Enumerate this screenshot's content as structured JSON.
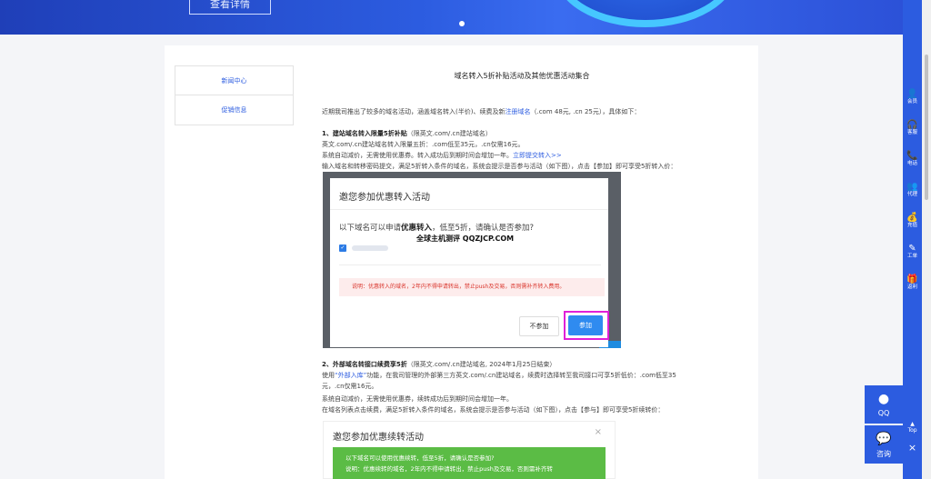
{
  "banner": {
    "detail_button": "查看详情"
  },
  "sidenav": {
    "items": [
      "新闻中心",
      "促销信息"
    ]
  },
  "article": {
    "title": "域名转入5折补贴活动及其他优惠活动集合",
    "intro_prefix": "近期我司推出了较多的域名活动，涵盖域名转入(半价)、续费及新",
    "intro_link": "注册域名",
    "intro_suffix": "（.com 48元, .cn 25元），具体如下：",
    "s1_head": "1、建站域名转入限量5折补贴",
    "s1_head_note": "（限英文.com/.cn建站域名）",
    "s1_l1": "英文.com/.cn建站域名转入限量五折：.com低至35元，.cn仅需16元。",
    "s1_l2_prefix": "系统自动减价，无需使用优惠券。转入成功后到期时间会增加一年。",
    "s1_l2_link": "立即提交转入>>",
    "s1_l3": "输入域名和转移密码提交，满足5折转入条件的域名，系统会提示是否参与活动（如下图），点击【参加】即可享受5折转入价：",
    "s2_head": "2、外部域名转接口续费享5折",
    "s2_head_note": "（限英文.com/.cn建站域名, 2024年1月25日结束）",
    "s2_l1_prefix": "使用",
    "s2_l1_link": "“外部入库”",
    "s2_l1_suffix": "功能，在我司管理的外部第三方英文.com/.cn建站域名，续费时选择转至我司接口可享5折低价：.com低至35",
    "s2_l2": "元，.cn仅需16元。",
    "s2_l3": "系统自动减价，无需使用优惠券，续转成功后到期时间会增加一年。",
    "s2_l4": "在域名列表点击续费，满足5折转入条件的域名，系统会提示是否参与活动（如下图），点击【参与】即可享受5折续转价："
  },
  "modal1": {
    "title": "邀您参加优惠转入活动",
    "question_prefix": "以下域名可以申请",
    "question_bold": "优惠转入",
    "question_suffix": "，低至5折，请确认是否参加?",
    "watermark": "全球主机测评 QQZJCP.COM",
    "note": "说明：优惠转入的域名，2年内不得申请转出，禁止push及交易，否则需补齐转入费用。",
    "cancel_label": "不参加",
    "confirm_label": "参加"
  },
  "modal2": {
    "title": "邀您参加优惠续转活动",
    "close": "×",
    "line1": "以下域名可以使用优惠续转，低至5折，请确认是否参加?",
    "line2": "说明：优惠续转的域名，2年内不得申请转出，禁止push及交易，否则需补齐转"
  },
  "right_bar": {
    "items": [
      {
        "icon": "person-icon",
        "glyph": "👤",
        "label": "会员"
      },
      {
        "icon": "headset-icon",
        "glyph": "🎧",
        "label": "客服"
      },
      {
        "icon": "phone-icon",
        "glyph": "📞",
        "label": "电话"
      },
      {
        "icon": "agent-icon",
        "glyph": "👥",
        "label": "代理"
      },
      {
        "icon": "money-bag-icon",
        "glyph": "💰",
        "label": "充值"
      },
      {
        "icon": "edit-icon",
        "glyph": "✎",
        "label": "工单"
      },
      {
        "icon": "gift-icon",
        "glyph": "🎁",
        "label": "返利"
      }
    ],
    "top_label": "Top",
    "close": "×"
  },
  "float": {
    "qq_label": "QQ",
    "ask_label": "咨询"
  },
  "colors": {
    "brand": "#2c5ce0",
    "confirm": "#2f8bf0",
    "highlight": "#e020d8",
    "warning": "#d9342b",
    "green": "#5bbc45"
  }
}
